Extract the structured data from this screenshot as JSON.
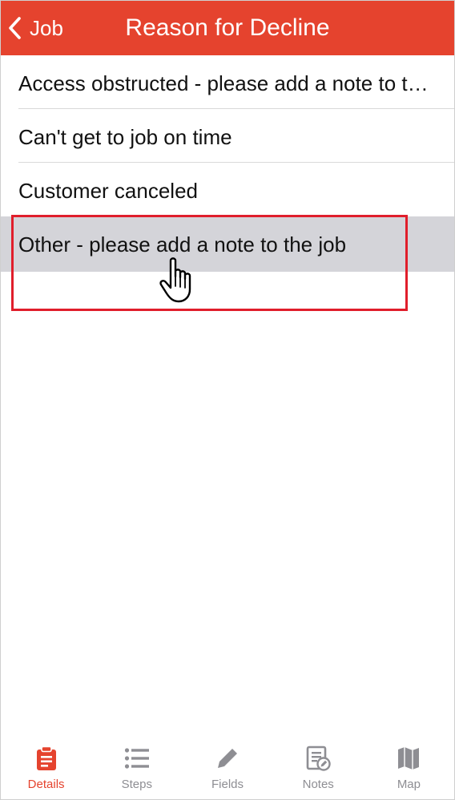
{
  "header": {
    "back_label": "Job",
    "title": "Reason for Decline"
  },
  "reasons": [
    {
      "label": "Access obstructed - please add a note to the job"
    },
    {
      "label": "Can't get to job on time"
    },
    {
      "label": "Customer canceled"
    },
    {
      "label": "Other - please add a note to the job",
      "selected": true
    }
  ],
  "tabs": [
    {
      "label": "Details",
      "icon": "clipboard-icon",
      "active": true
    },
    {
      "label": "Steps",
      "icon": "list-icon"
    },
    {
      "label": "Fields",
      "icon": "pencil-icon"
    },
    {
      "label": "Notes",
      "icon": "notes-icon"
    },
    {
      "label": "Map",
      "icon": "map-icon"
    }
  ],
  "colors": {
    "accent": "#e5432e",
    "selected_row": "#d4d4d9",
    "highlight_box": "#e01e2b",
    "inactive_tab": "#8e8e93"
  }
}
